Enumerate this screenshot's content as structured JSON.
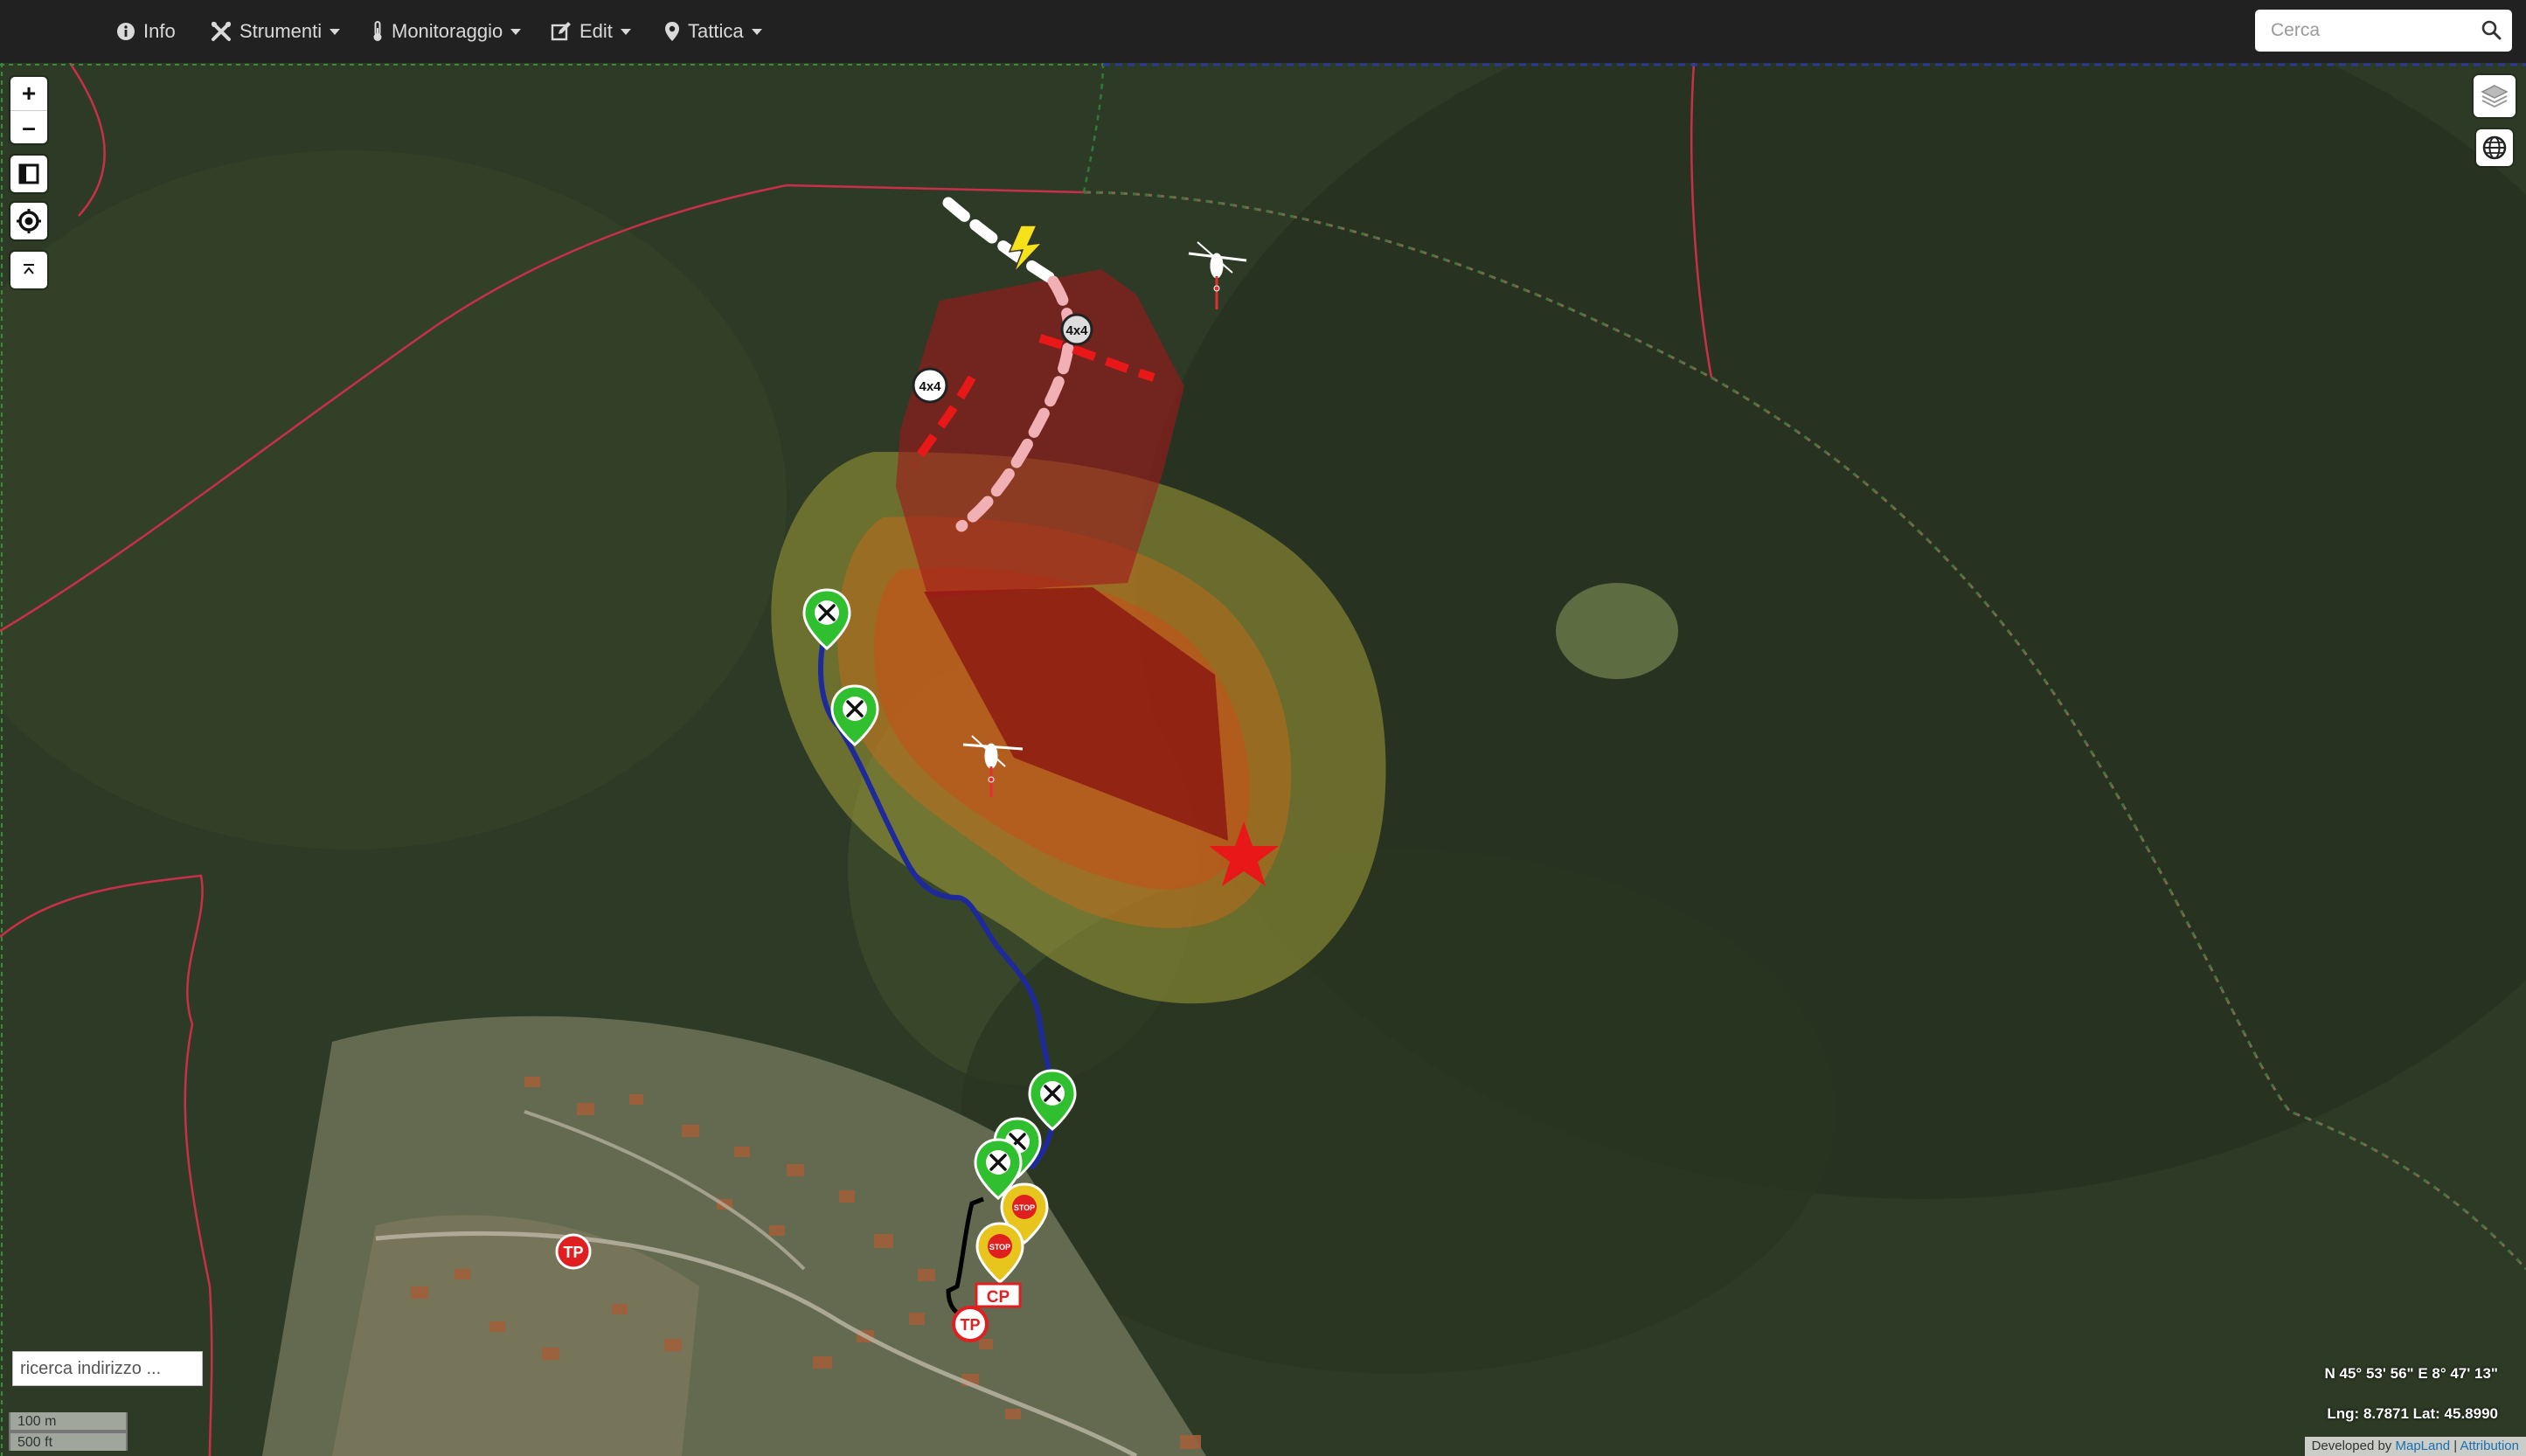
{
  "navbar": {
    "items": [
      {
        "label": "Info",
        "icon": "info-circle-icon",
        "dropdown": false
      },
      {
        "label": "Strumenti",
        "icon": "tools-icon",
        "dropdown": true
      },
      {
        "label": "Monitoraggio",
        "icon": "thermometer-icon",
        "dropdown": true
      },
      {
        "label": "Edit",
        "icon": "edit-icon",
        "dropdown": true
      },
      {
        "label": "Tattica",
        "icon": "map-marker-icon",
        "dropdown": true
      }
    ],
    "search_placeholder": "Cerca"
  },
  "map": {
    "address_search_placeholder": "ricerca indirizzo ...",
    "scale": {
      "metric": "100 m",
      "imperial": "500 ft"
    },
    "coordinates_dms": "N 45° 53' 56\" E 8° 47' 13\"",
    "coordinates_decimal": "Lng: 8.7871 Lat: 45.8990",
    "attribution": {
      "prefix": "Developed by ",
      "link1": "MapLand",
      "separator": " | ",
      "link2": "Attribution"
    },
    "markers": {
      "vehicle_label": "4x4",
      "tp_label": "TP",
      "cp_label": "CP",
      "stop_label": "STOP"
    },
    "colors": {
      "zone_red": "#8b1a10",
      "zone_orange": "#d1701e",
      "zone_yellow": "#b8b43c",
      "route_blue": "#1e2a9a",
      "marker_green": "#2fbf2f",
      "marker_yellow": "#e8c51c",
      "boundary_red": "#c8304a"
    }
  }
}
